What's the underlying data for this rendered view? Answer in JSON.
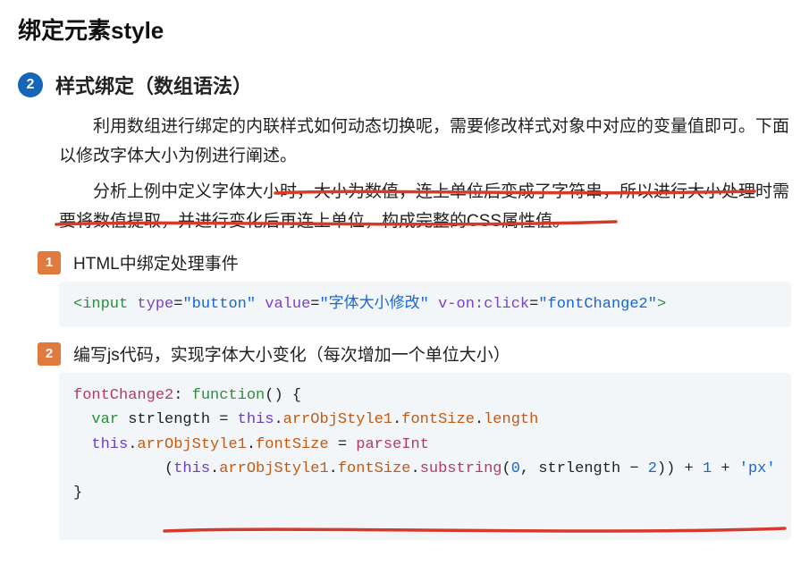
{
  "page": {
    "title": "绑定元素style"
  },
  "section": {
    "badge": "2",
    "title": "样式绑定（数组语法）"
  },
  "paras": {
    "p1": "利用数组进行绑定的内联样式如何动态切换呢，需要修改样式对象中对应的变量值即可。下面以修改字体大小为例进行阐述。",
    "p2": "分析上例中定义字体大小时，大小为数值，连上单位后变成了字符串，所以进行大小处理时需要将数值提取，并进行变化后再连上单位，构成完整的CSS属性值。"
  },
  "steps": {
    "s1": {
      "badge": "1",
      "title": "HTML中绑定处理事件"
    },
    "s2": {
      "badge": "2",
      "title": "编写js代码，实现字体大小变化（每次增加一个单位大小）"
    }
  },
  "code1": {
    "tag_open": "<input",
    "attr_type": "type",
    "val_type": "\"button\"",
    "attr_value": "value",
    "val_value": "\"字体大小修改\"",
    "attr_click": "v-on:click",
    "val_click": "\"fontChange2\"",
    "tag_close": ">"
  },
  "code2": {
    "l1_key": "fontChange2",
    "l1_mid": ": ",
    "l1_fn": "function",
    "l1_tail": "() {",
    "l2_indent": "  ",
    "l2_var": "var",
    "l2_name": " strlength = ",
    "l2_this": "this",
    "l2_dot1": ".",
    "l2_arr": "arrObjStyle1",
    "l2_dot2": ".",
    "l2_fs": "fontSize",
    "l2_dot3": ".",
    "l2_len": "length",
    "l3_indent": "  ",
    "l3_this": "this",
    "l3_dot1": ".",
    "l3_arr": "arrObjStyle1",
    "l3_dot2": ".",
    "l3_fs": "fontSize",
    "l3_eq": " = ",
    "l3_pi": "parseInt",
    "l4_indent": "          (",
    "l4_this": "this",
    "l4_dot1": ".",
    "l4_arr": "arrObjStyle1",
    "l4_dot2": ".",
    "l4_fs": "fontSize",
    "l4_dot3": ".",
    "l4_sub": "substring",
    "l4_open": "(",
    "l4_zero": "0",
    "l4_comma": ", strlength − ",
    "l4_two": "2",
    "l4_close": ")) + ",
    "l4_one": "1",
    "l4_plus": " + ",
    "l4_px": "'px'",
    "l5": "}"
  }
}
